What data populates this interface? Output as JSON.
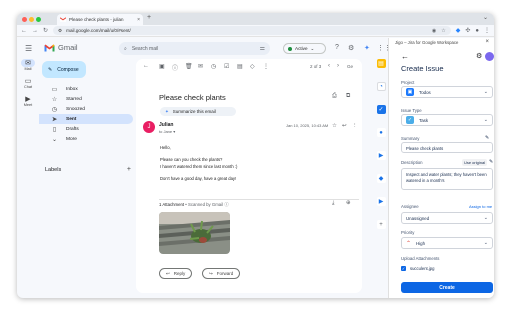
{
  "browser": {
    "tab_title": "Please check plants - julian",
    "url": "mail.google.com/mail/u/0/#sent/",
    "tab_close": "×",
    "new_tab": "+"
  },
  "gmail": {
    "logo_text": "Gmail",
    "search_placeholder": "Search mail",
    "status_label": "Active",
    "compose_label": "Compose",
    "rail": [
      {
        "icon": "mail-icon",
        "label": "Mail"
      },
      {
        "icon": "chat-icon",
        "label": "Chat"
      },
      {
        "icon": "meet-icon",
        "label": "Meet"
      }
    ],
    "nav": [
      {
        "icon": "inbox-icon",
        "label": "Inbox",
        "active": false
      },
      {
        "icon": "star-icon",
        "label": "Starred",
        "active": false
      },
      {
        "icon": "snooze-icon",
        "label": "Snoozed",
        "active": false
      },
      {
        "icon": "sent-icon",
        "label": "Sent",
        "active": true
      },
      {
        "icon": "draft-icon",
        "label": "Drafts",
        "active": false
      },
      {
        "icon": "chevron-down-icon",
        "label": "More",
        "active": false
      }
    ],
    "labels_heading": "Labels",
    "pagination": "2 of 3",
    "lang_badge": "Ge"
  },
  "email": {
    "subject": "Please check plants",
    "summarize_label": "Summarize this email",
    "sender": "Julian",
    "sender_initial": "J",
    "to": "to Jane",
    "date": "Jan 10, 2025, 10:43 AM",
    "body": [
      "Hello,",
      "Please can you check the plants?",
      "I haven't watered them since last month :)",
      "Don't have a good day, have a great day!"
    ],
    "attachment_header": "1 Attachment",
    "scanned_by": "• Scanned by Gmail",
    "reply_label": "Reply",
    "forward_label": "Forward"
  },
  "jira": {
    "panel_title": "Jigo – Jira for Google Workspace",
    "heading": "Create Issue",
    "project_label": "Project",
    "project_value": "Todos",
    "issue_type_label": "Issue Type",
    "issue_type_value": "Task",
    "summary_label": "Summary",
    "summary_value": "Please check plants",
    "description_label": "Description",
    "use_original_label": "Use original",
    "description_value": "Inspect and water plants; they haven't been watered in a month's",
    "assignee_label": "Assignee",
    "assign_me_label": "Assign to me",
    "assignee_value": "Unassigned",
    "priority_label": "Priority",
    "priority_value": "High",
    "upload_label": "Upload Attachments",
    "attachment_file": "succulent.jpg",
    "create_label": "Create"
  }
}
